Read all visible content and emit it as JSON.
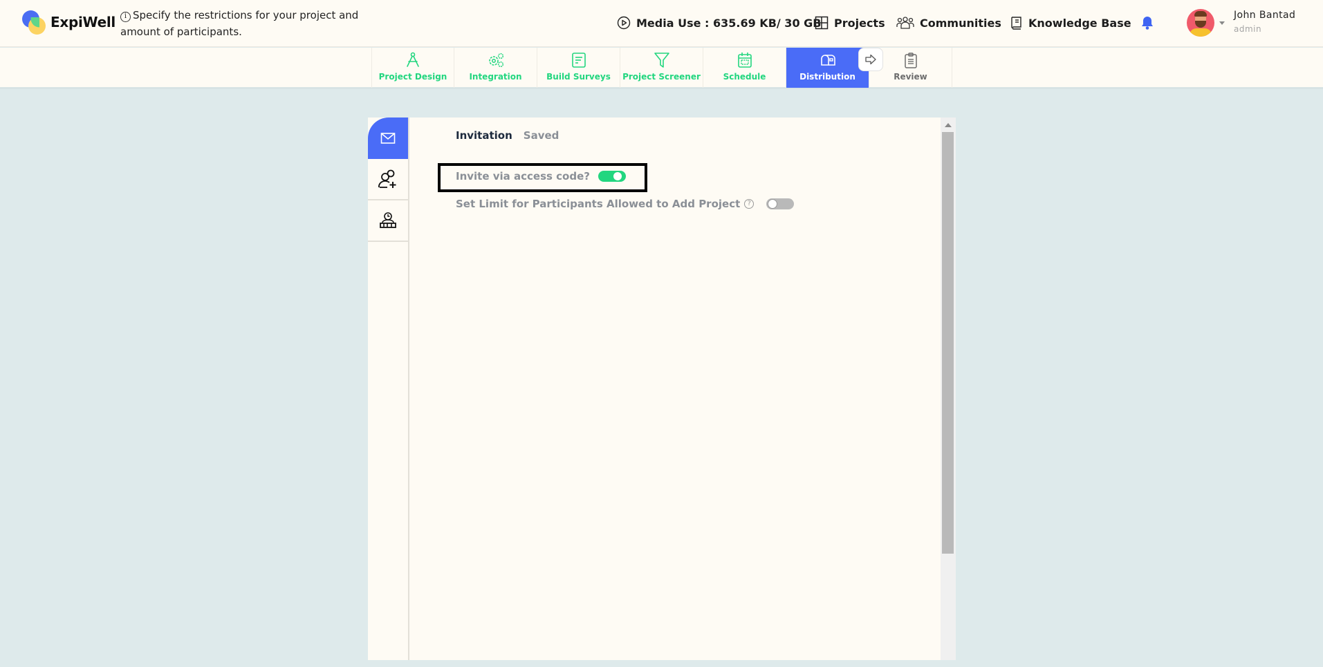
{
  "header": {
    "brand": "ExpiWell",
    "hint": "Specify the restrictions for your project and amount of participants.",
    "media_use": "Media Use : 635.69 KB/ 30 GB",
    "nav": {
      "projects": "Projects",
      "communities": "Communities",
      "knowledge_base": "Knowledge Base"
    },
    "user": {
      "name": "John Bantad",
      "role": "admin"
    }
  },
  "steps": [
    {
      "label": "Project Design",
      "icon": "compass-icon",
      "state": "done"
    },
    {
      "label": "Integration",
      "icon": "gears-icon",
      "state": "done"
    },
    {
      "label": "Build Surveys",
      "icon": "document-icon",
      "state": "done"
    },
    {
      "label": "Project Screener",
      "icon": "filter-icon",
      "state": "done"
    },
    {
      "label": "Schedule",
      "icon": "calendar-icon",
      "state": "done"
    },
    {
      "label": "Distribution",
      "icon": "mailbox-icon",
      "state": "active"
    },
    {
      "label": "Review",
      "icon": "clipboard-icon",
      "state": "disabled"
    }
  ],
  "panel": {
    "sidebar": [
      {
        "icon": "envelope-icon",
        "active": true
      },
      {
        "icon": "add-users-icon",
        "active": false
      },
      {
        "icon": "schedule-people-icon",
        "active": false
      }
    ],
    "tabs": [
      {
        "label": "Invitation",
        "active": true
      },
      {
        "label": "Saved",
        "active": false
      }
    ],
    "fields": {
      "invite_access_code": {
        "label": "Invite via access code?",
        "enabled": true
      },
      "limit_participants": {
        "label": "Set Limit for Participants Allowed to Add Project",
        "help": "?",
        "enabled": false
      }
    }
  },
  "colors": {
    "accent_blue": "#4a6cf7",
    "accent_green": "#22d67f",
    "background": "#deeaeb",
    "surface": "#fefbf4"
  }
}
